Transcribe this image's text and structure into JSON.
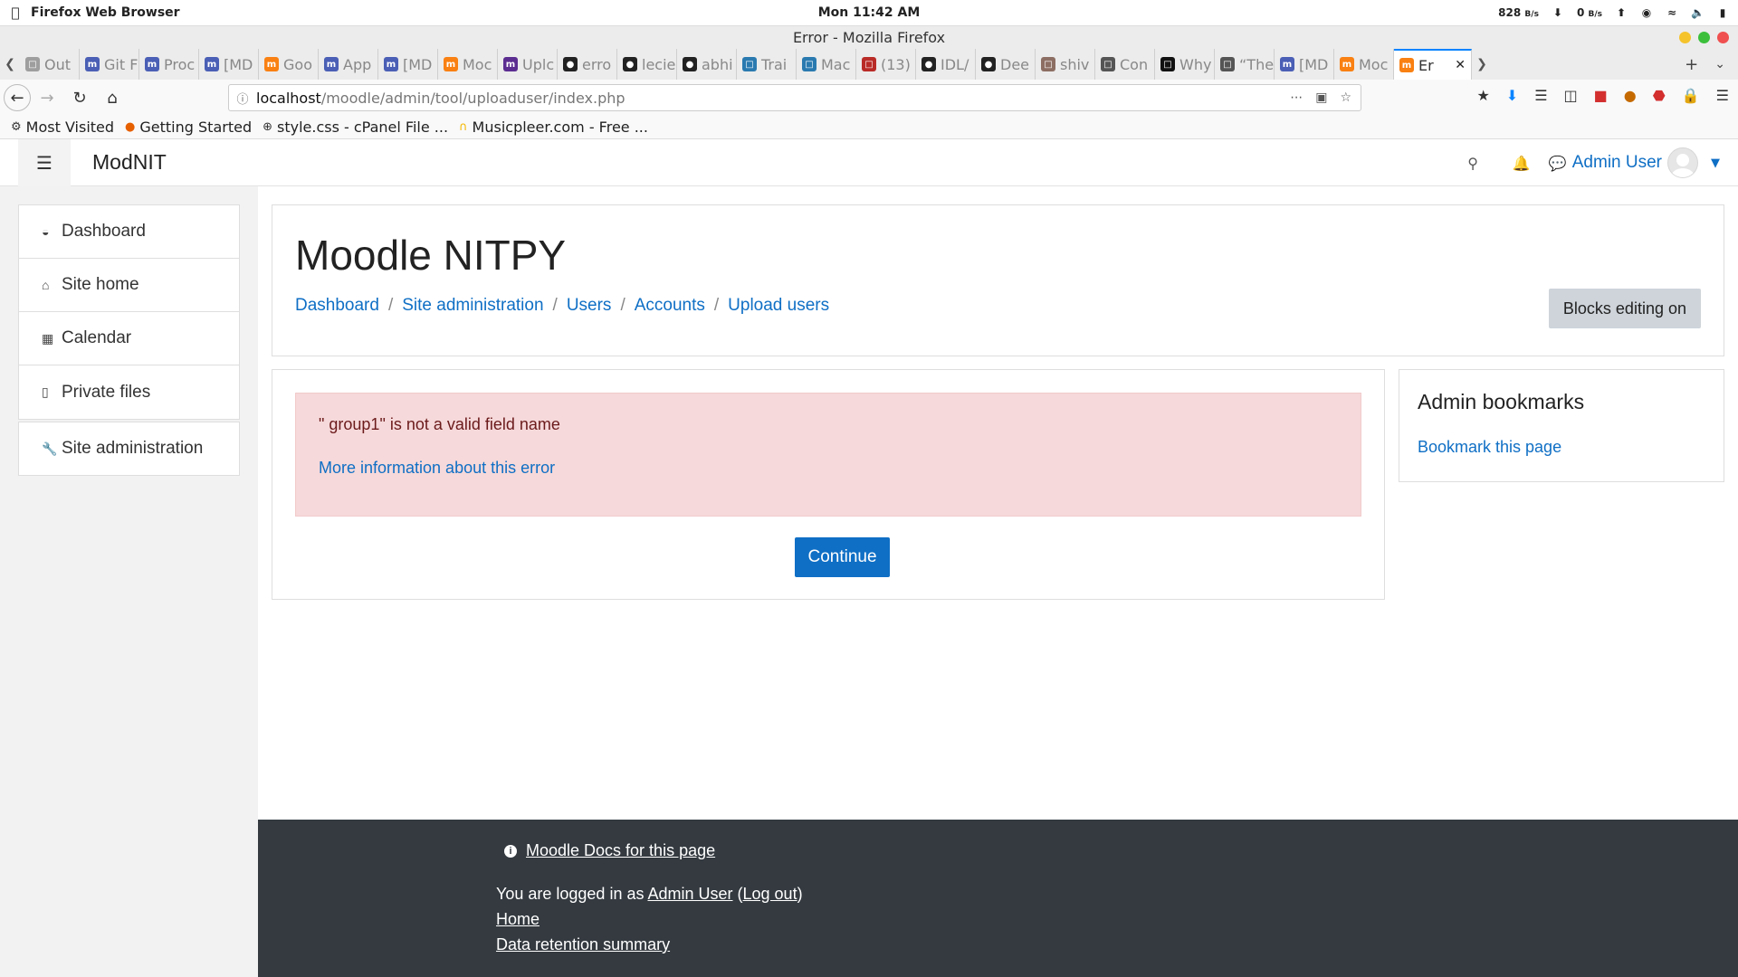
{
  "os": {
    "app_name": "Firefox Web Browser",
    "clock": "Mon 11:42 AM",
    "net_down": "828",
    "net_down_unit": "B/s",
    "net_up": "0",
    "net_up_unit": "B/s"
  },
  "window": {
    "title": "Error - Mozilla Firefox"
  },
  "tabs": [
    {
      "label": "Out",
      "icon": "outlook-icon",
      "color": "#9e9e9e"
    },
    {
      "label": "Git F",
      "icon": "moodle-icon",
      "color": "#4a5fb5"
    },
    {
      "label": "Proc",
      "icon": "moodle-icon",
      "color": "#4a5fb5"
    },
    {
      "label": "[MD",
      "icon": "moodle-icon",
      "color": "#4a5fb5"
    },
    {
      "label": "Goo",
      "icon": "moodle-icon",
      "color": "#f98012"
    },
    {
      "label": "App",
      "icon": "moodle-icon",
      "color": "#4a5fb5"
    },
    {
      "label": "[MD",
      "icon": "moodle-icon",
      "color": "#4a5fb5"
    },
    {
      "label": "Moc",
      "icon": "moodle-icon",
      "color": "#f98012"
    },
    {
      "label": "Uplc",
      "icon": "moodle-icon",
      "color": "#5c2d91"
    },
    {
      "label": "erro",
      "icon": "github-icon",
      "color": "#222222"
    },
    {
      "label": "lecie",
      "icon": "github-icon",
      "color": "#222222"
    },
    {
      "label": "abhi",
      "icon": "github-icon",
      "color": "#222222"
    },
    {
      "label": "Trai",
      "icon": "js-icon",
      "color": "#2a7ab0"
    },
    {
      "label": "Mac",
      "icon": "js-icon",
      "color": "#2a7ab0"
    },
    {
      "label": "(13)",
      "icon": "quora-icon",
      "color": "#b92b27"
    },
    {
      "label": "IDL/",
      "icon": "github-icon",
      "color": "#222222"
    },
    {
      "label": "Dee",
      "icon": "github-icon",
      "color": "#222222"
    },
    {
      "label": "shiv",
      "icon": "image-icon",
      "color": "#8d6e63"
    },
    {
      "label": "Con",
      "icon": "page-icon",
      "color": "#555555"
    },
    {
      "label": "Why",
      "icon": "medium-icon",
      "color": "#111111"
    },
    {
      "label": "“The",
      "icon": "page-icon",
      "color": "#555555"
    },
    {
      "label": "[MD",
      "icon": "moodle-icon",
      "color": "#4a5fb5"
    },
    {
      "label": "Moc",
      "icon": "moodle-icon",
      "color": "#f98012"
    },
    {
      "label": "Er",
      "icon": "moodle-icon",
      "color": "#f98012",
      "active": true
    }
  ],
  "url": {
    "host": "localhost",
    "path": "/moodle/admin/tool/uploaduser/index.php"
  },
  "bookmarks": [
    {
      "label": "Most Visited",
      "icon": "gear-icon"
    },
    {
      "label": "Getting Started",
      "icon": "firefox-icon"
    },
    {
      "label": "style.css - cPanel File ...",
      "icon": "globe-icon"
    },
    {
      "label": "Musicpleer.com - Free ...",
      "icon": "headphones-icon"
    }
  ],
  "header": {
    "site_name": "ModNIT",
    "user_name": "Admin User"
  },
  "nav": {
    "items": [
      {
        "label": "Dashboard",
        "icon": "dashboard-icon"
      },
      {
        "label": "Site home",
        "icon": "home-icon"
      },
      {
        "label": "Calendar",
        "icon": "calendar-icon"
      },
      {
        "label": "Private files",
        "icon": "file-icon"
      }
    ],
    "admin": {
      "label": "Site administration",
      "icon": "wrench-icon"
    }
  },
  "page": {
    "title": "Moodle NITPY",
    "breadcrumb": [
      "Dashboard",
      "Site administration",
      "Users",
      "Accounts",
      "Upload users"
    ],
    "blocks_editing_label": "Blocks editing on"
  },
  "error": {
    "message": "\" group1\" is not a valid field name",
    "more_info": "More information about this error",
    "continue_label": "Continue",
    "bg_color": "#f6d9da"
  },
  "admin_bookmarks": {
    "title": "Admin bookmarks",
    "link": "Bookmark this page"
  },
  "footer": {
    "docs_link": "Moodle Docs for this page",
    "logged_prefix": "You are logged in as ",
    "logged_user": "Admin User",
    "logout": "Log out",
    "home": "Home",
    "retention": "Data retention summary"
  },
  "colors": {
    "link": "#0f6fc5",
    "footer_bg": "#343a40",
    "primary_button": "#0f6fc5"
  }
}
